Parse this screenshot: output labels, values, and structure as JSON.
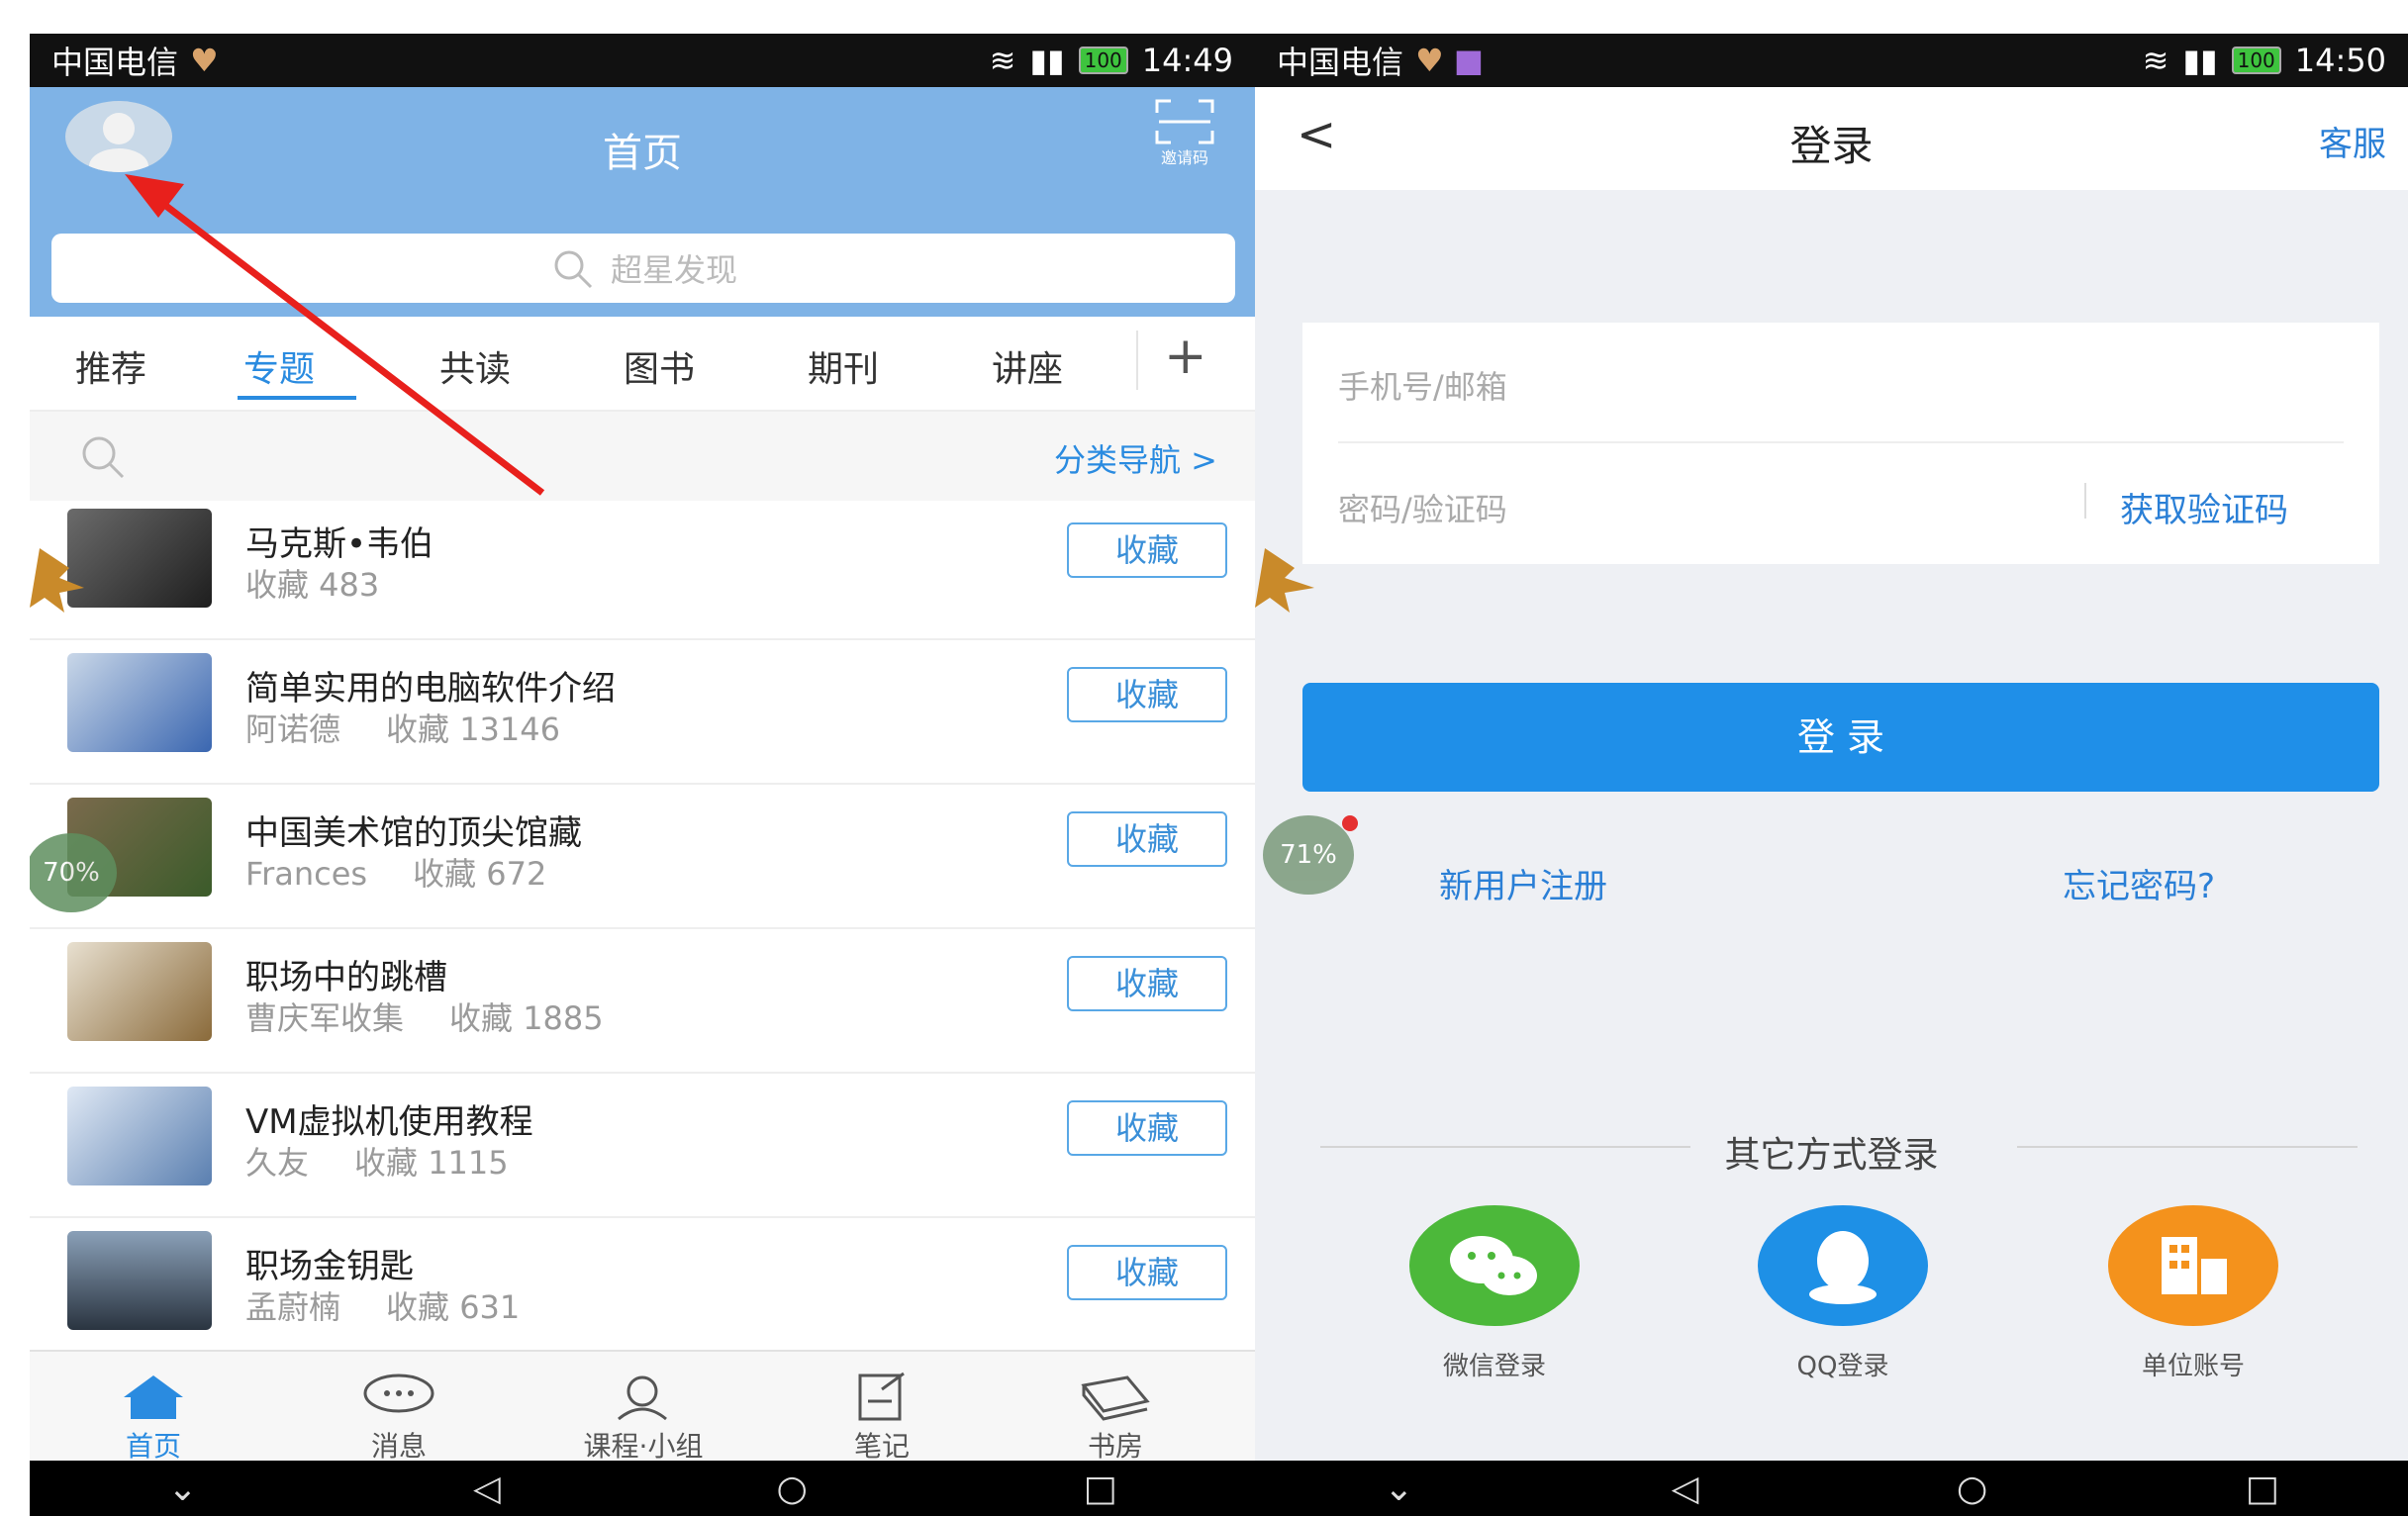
{
  "left": {
    "status": {
      "carrier": "中国电信",
      "time": "14:49",
      "battery": "100"
    },
    "header": {
      "title": "首页",
      "invite_label": "邀请码",
      "search_placeholder": "超星发现"
    },
    "tabs": [
      "推荐",
      "专题",
      "共读",
      "图书",
      "期刊",
      "讲座"
    ],
    "add_tab": "+",
    "category_nav": "分类导航 >",
    "items": [
      {
        "title": "马克斯•韦伯",
        "author": "",
        "count": "收藏 483"
      },
      {
        "title": "简单实用的电脑软件介绍",
        "author": "阿诺德",
        "count": "收藏 13146"
      },
      {
        "title": "中国美术馆的顶尖馆藏",
        "author": "Frances",
        "count": "收藏 672"
      },
      {
        "title": "职场中的跳槽",
        "author": "曹庆军收集",
        "count": "收藏 1885"
      },
      {
        "title": "VM虚拟机使用教程",
        "author": "久友",
        "count": "收藏 1115"
      },
      {
        "title": "职场金钥匙",
        "author": "孟蔚楠",
        "count": "收藏 631"
      }
    ],
    "fav_label": "收藏",
    "overlay_percent": "70%",
    "bottom_nav": [
      "首页",
      "消息",
      "课程·小组",
      "笔记",
      "书房"
    ],
    "colors": {
      "header": "#7fb3e6",
      "accent": "#2a8be0",
      "arrow": "#e8201c"
    }
  },
  "right": {
    "status": {
      "carrier": "中国电信",
      "time": "14:50",
      "battery": "100"
    },
    "header": {
      "back": "<",
      "title": "登录",
      "service": "客服"
    },
    "phone_placeholder": "手机号/邮箱",
    "password_placeholder": "密码/验证码",
    "get_code": "获取验证码",
    "login_button": "登 录",
    "register": "新用户注册",
    "forgot": "忘记密码?",
    "overlay_percent": "71%",
    "other_login": "其它方式登录",
    "methods": [
      {
        "label": "微信登录",
        "icon": "wechat-icon",
        "color": "#4cb83a"
      },
      {
        "label": "QQ登录",
        "icon": "qq-icon",
        "color": "#1e90e6"
      },
      {
        "label": "单位账号",
        "icon": "building-icon",
        "color": "#f4921c"
      }
    ],
    "colors": {
      "button": "#1f8fe8",
      "link": "#2a7fd6"
    }
  }
}
